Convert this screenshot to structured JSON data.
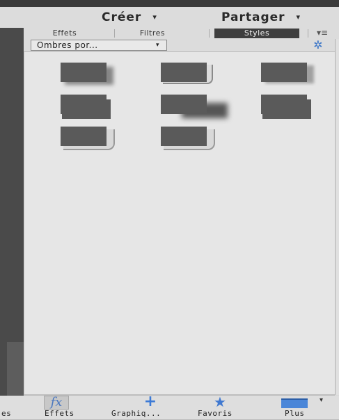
{
  "header": {
    "create_label": "Créer",
    "share_label": "Partager",
    "caret": "▾"
  },
  "tabs": [
    {
      "label": "Effets",
      "active": false
    },
    {
      "label": "Filtres",
      "active": false
    },
    {
      "label": "Styles",
      "active": true
    }
  ],
  "tab_menu_icon": "menu-icon",
  "tab_menu_glyph": "▾≡",
  "style_select": {
    "value": "Ombres por...",
    "caret": "▾"
  },
  "settings_icon": "gear-icon",
  "settings_glyph": "✲",
  "styles": [
    {
      "name": "soft-drop-shadow",
      "icon": "style-thumbnail"
    },
    {
      "name": "outline-shadow",
      "icon": "style-thumbnail"
    },
    {
      "name": "soft-edge-shadow",
      "icon": "style-thumbnail"
    },
    {
      "name": "low-shadow",
      "icon": "style-thumbnail"
    },
    {
      "name": "diagonal-shadow",
      "icon": "style-thumbnail"
    },
    {
      "name": "blur-shadow",
      "icon": "style-thumbnail"
    },
    {
      "name": "bevel-shadow",
      "icon": "style-thumbnail"
    },
    {
      "name": "outer-bevel-shadow",
      "icon": "style-thumbnail"
    }
  ],
  "bottom_bar": {
    "partial_left": "es",
    "items": [
      {
        "label": "Effets",
        "icon": "fx-icon",
        "glyph": "fx"
      },
      {
        "label": "Graphiq...",
        "icon": "plus-icon",
        "glyph": "+"
      },
      {
        "label": "Favoris",
        "icon": "star-icon",
        "glyph": "★"
      },
      {
        "label": "Plus",
        "icon": "window-icon",
        "glyph": "▾"
      }
    ]
  },
  "colors": {
    "accent_blue": "#3f78c8",
    "active_tab_bg": "#3f3f3f",
    "panel_bg": "#e6e6e6"
  }
}
